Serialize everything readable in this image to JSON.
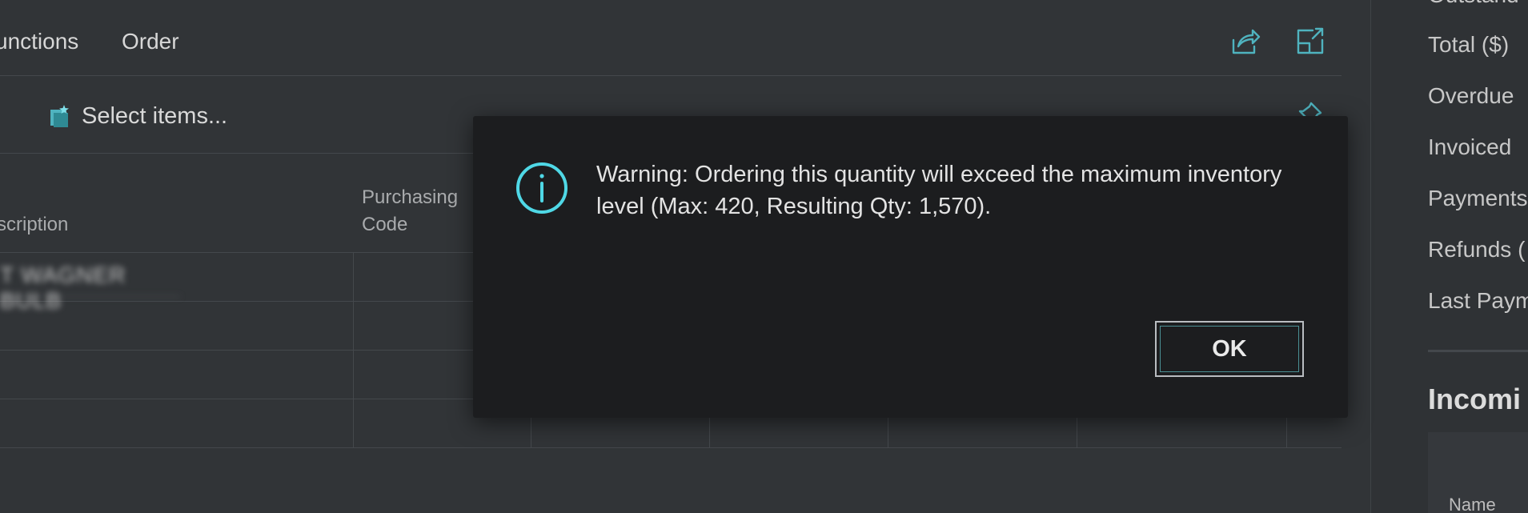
{
  "colors": {
    "accent": "#4fb3bf",
    "info_icon": "#4fd8e6",
    "background": "#313437",
    "dialog_bg": "#1c1d1f"
  },
  "action_bar": {
    "items": [
      "unctions",
      "Order"
    ],
    "icons": [
      "share-icon",
      "open-in-new-window-icon"
    ]
  },
  "lines_bar": {
    "select_items_label": "Select items...",
    "pin_icon": "pin-icon"
  },
  "grid": {
    "columns": [
      {
        "label": "scription"
      },
      {
        "label": "Purchasing\nCode"
      }
    ],
    "rows": [
      {
        "description": "T WAGNER BULB"
      },
      {
        "description": ""
      },
      {
        "description": ""
      },
      {
        "description": ""
      }
    ]
  },
  "factbox": {
    "labels": [
      "Outstand",
      "Total ($)",
      "Overdue",
      "Invoiced",
      "Payments",
      "Refunds (",
      "Last Paym"
    ],
    "section_heading": "Incomi",
    "card_label": "Name"
  },
  "dialog": {
    "icon": "info-icon",
    "message": "Warning: Ordering this quantity will exceed the maximum inventory level (Max: 420, Resulting Qty: 1,570).",
    "ok_label": "OK"
  }
}
